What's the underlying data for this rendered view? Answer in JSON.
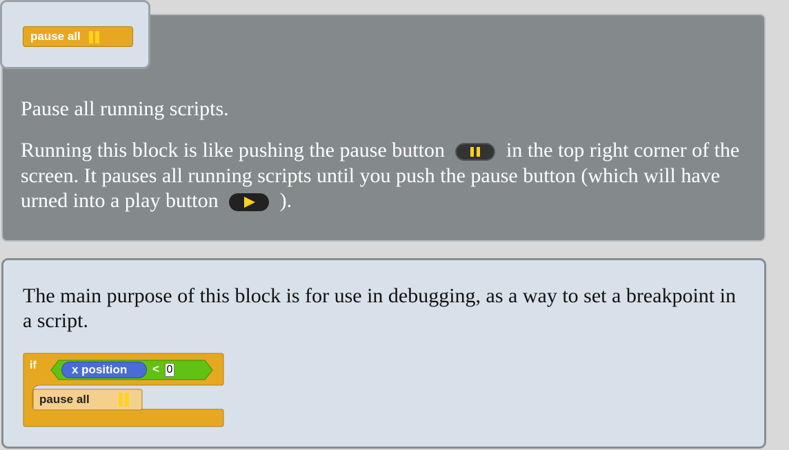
{
  "help": {
    "block_label": "pause all",
    "heading": "Pause all running scripts.",
    "para_before_pause": "Running this block is like pushing the pause button",
    "para_after_pause": "in the top right corner of the screen. It pauses all running scripts until you push the pause button (which will have urned into a play button",
    "para_end": ").",
    "purpose": "The main purpose of this block is for use in debugging, as a way to set a breakpoint in a script."
  },
  "example_script": {
    "if_label": "if",
    "reporter_label": "x position",
    "operator": "<",
    "value": "0",
    "command_label": "pause all"
  },
  "colors": {
    "control_block": "#e6a821",
    "motion_reporter": "#4a6cd4",
    "operator_block": "#62c213",
    "pause_glyph": "#ffd21f"
  }
}
